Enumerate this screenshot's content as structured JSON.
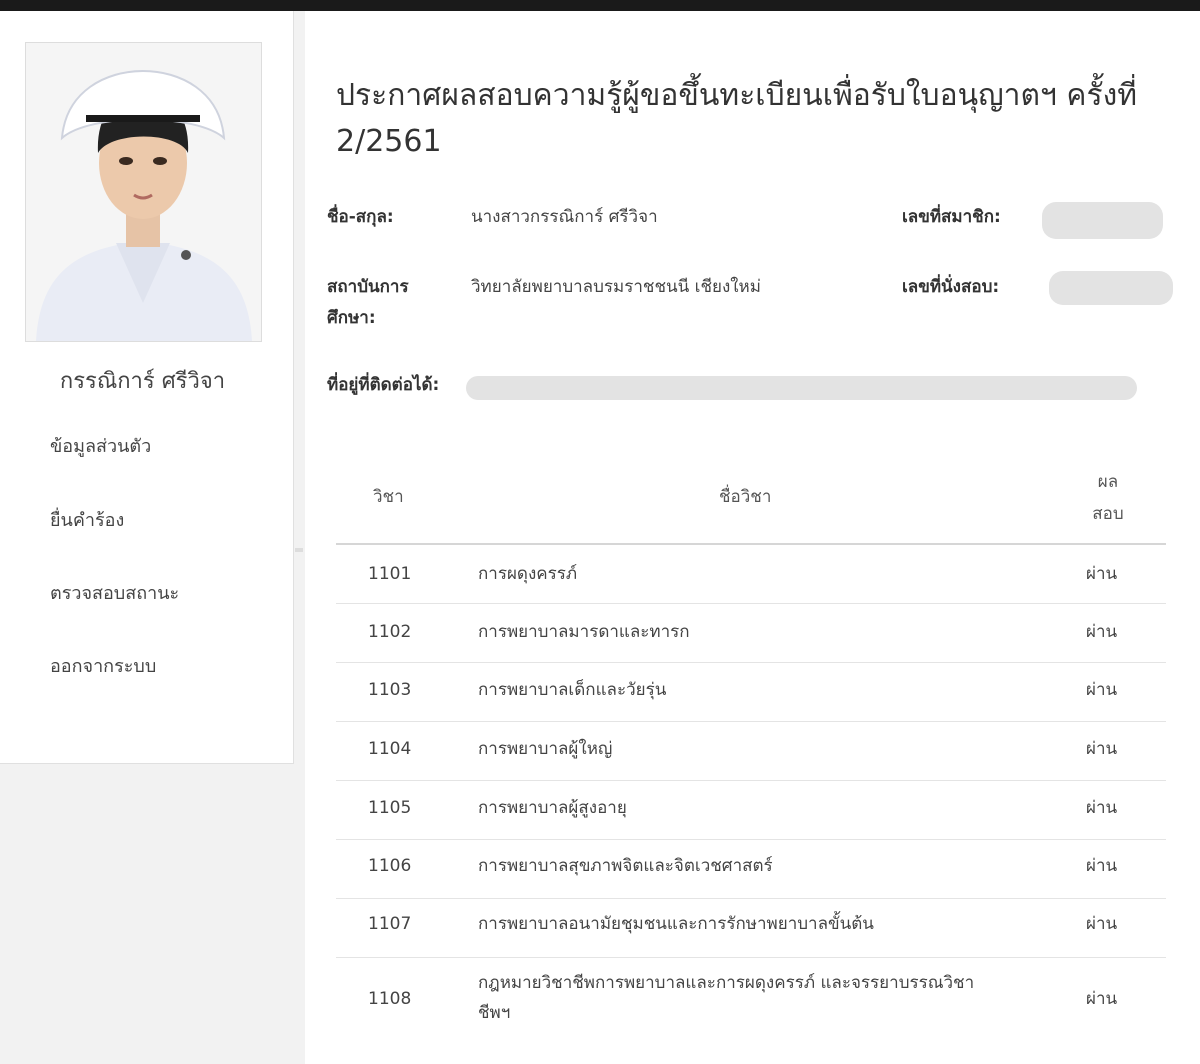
{
  "profile": {
    "name": "กรรณิการ์ ศรีวิจา"
  },
  "menu": {
    "items": [
      {
        "label": "ข้อมูลส่วนตัว"
      },
      {
        "label": "ยื่นคำร้อง"
      },
      {
        "label": "ตรวจสอบสถานะ"
      },
      {
        "label": "ออกจากระบบ"
      }
    ]
  },
  "announcement": {
    "title": "ประกาศผลสอบความรู้ผู้ขอขึ้นทะเบียนเพื่อรับใบอนุญาตฯ ครั้งที่ 2/2561"
  },
  "info": {
    "name_label": "ชื่อ-สกุล:",
    "name_value": "นางสาวกรรณิการ์ ศรีวิจา",
    "member_label": "เลขที่สมาชิก:",
    "institution_label": "สถาบันการศึกษา:",
    "institution_value": "วิทยาลัยพยาบาลบรมราชชนนี เชียงใหม่",
    "seat_label": "เลขที่นั่งสอบ:",
    "address_label": "ที่อยู่ที่ติดต่อได้:"
  },
  "table": {
    "headers": {
      "code": "วิชา",
      "name": "ชื่อวิชา",
      "result": "ผลสอบ"
    },
    "rows": [
      {
        "code": "1101",
        "name": "การผดุงครรภ์",
        "result": "ผ่าน"
      },
      {
        "code": "1102",
        "name": "การพยาบาลมารดาและทารก",
        "result": "ผ่าน"
      },
      {
        "code": "1103",
        "name": "การพยาบาลเด็กและวัยรุ่น",
        "result": "ผ่าน"
      },
      {
        "code": "1104",
        "name": "การพยาบาลผู้ใหญ่",
        "result": "ผ่าน"
      },
      {
        "code": "1105",
        "name": "การพยาบาลผู้สูงอายุ",
        "result": "ผ่าน"
      },
      {
        "code": "1106",
        "name": "การพยาบาลสุขภาพจิตและจิตเวชศาสตร์",
        "result": "ผ่าน"
      },
      {
        "code": "1107",
        "name": "การพยาบาลอนามัยชุมชนและการรักษาพยาบาลขั้นต้น",
        "result": "ผ่าน"
      },
      {
        "code": "1108",
        "name": "กฎหมายวิชาชีพการพยาบาลและการผดุงครรภ์ และจรรยาบรรณวิชาชีพฯ",
        "result": "ผ่าน"
      }
    ]
  },
  "colors": {
    "page_bg": "#f2f2f2",
    "panel_bg": "#ffffff",
    "redacted": "#e3e3e3"
  }
}
